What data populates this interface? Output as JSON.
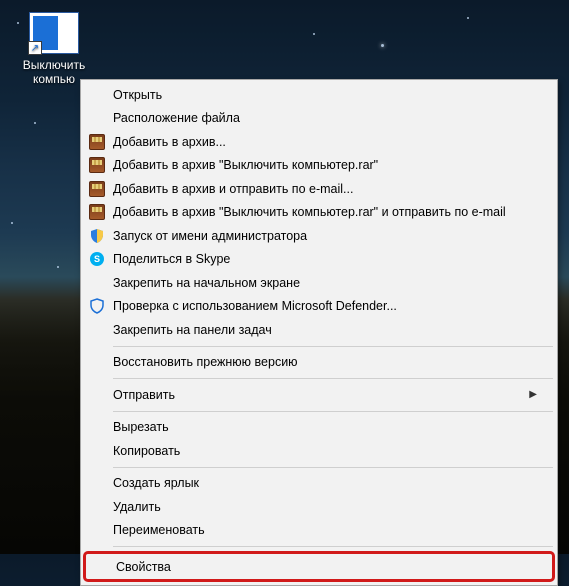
{
  "desktop": {
    "icon_label": "Выключить компью"
  },
  "menu": {
    "open": "Открыть",
    "file_location": "Расположение файла",
    "add_archive": "Добавить в архив...",
    "add_named": "Добавить в архив \"Выключить компьютер.rar\"",
    "add_email": "Добавить в архив и отправить по e-mail...",
    "add_named_email": "Добавить в архив \"Выключить компьютер.rar\" и отправить по e-mail",
    "run_as_admin": "Запуск от имени администратора",
    "share_skype": "Поделиться в Skype",
    "pin_start": "Закрепить на начальном экране",
    "defender_scan": "Проверка с использованием Microsoft Defender...",
    "pin_taskbar": "Закрепить на панели задач",
    "restore_version": "Восстановить прежнюю версию",
    "send_to": "Отправить",
    "cut": "Вырезать",
    "copy": "Копировать",
    "create_shortcut": "Создать ярлык",
    "delete": "Удалить",
    "rename": "Переименовать",
    "properties": "Свойства"
  }
}
